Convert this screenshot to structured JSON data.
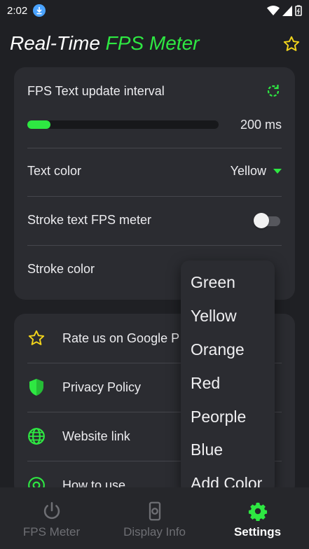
{
  "status": {
    "time": "2:02"
  },
  "header": {
    "title_part1": "Real-Time ",
    "title_part2": "FPS Meter"
  },
  "settings": {
    "fps_interval_label": "FPS Text update interval",
    "fps_interval_value": "200 ms",
    "fps_interval_fraction": 0.12,
    "text_color_label": "Text color",
    "text_color_value": "Yellow",
    "stroke_label": "Stroke text FPS meter",
    "stroke_enabled": false,
    "stroke_color_label": "Stroke color"
  },
  "links": [
    {
      "label": "Rate us on Google P",
      "icon": "star-icon"
    },
    {
      "label": "Privacy Policy",
      "icon": "shield-icon"
    },
    {
      "label": "Website link",
      "icon": "globe-icon"
    },
    {
      "label": "How to use",
      "icon": "help-icon"
    }
  ],
  "color_menu": [
    "Green",
    "Yellow",
    "Orange",
    "Red",
    "Peorple",
    "Blue",
    "Add Color"
  ],
  "nav": [
    {
      "label": "FPS Meter",
      "icon": "power-icon",
      "active": false
    },
    {
      "label": "Display Info",
      "icon": "display-info-icon",
      "active": false
    },
    {
      "label": "Settings",
      "icon": "gear-icon",
      "active": true
    }
  ],
  "colors": {
    "accent": "#2ee842",
    "star": "#f3d51b",
    "background": "#1f2024",
    "card": "#2b2c31"
  }
}
